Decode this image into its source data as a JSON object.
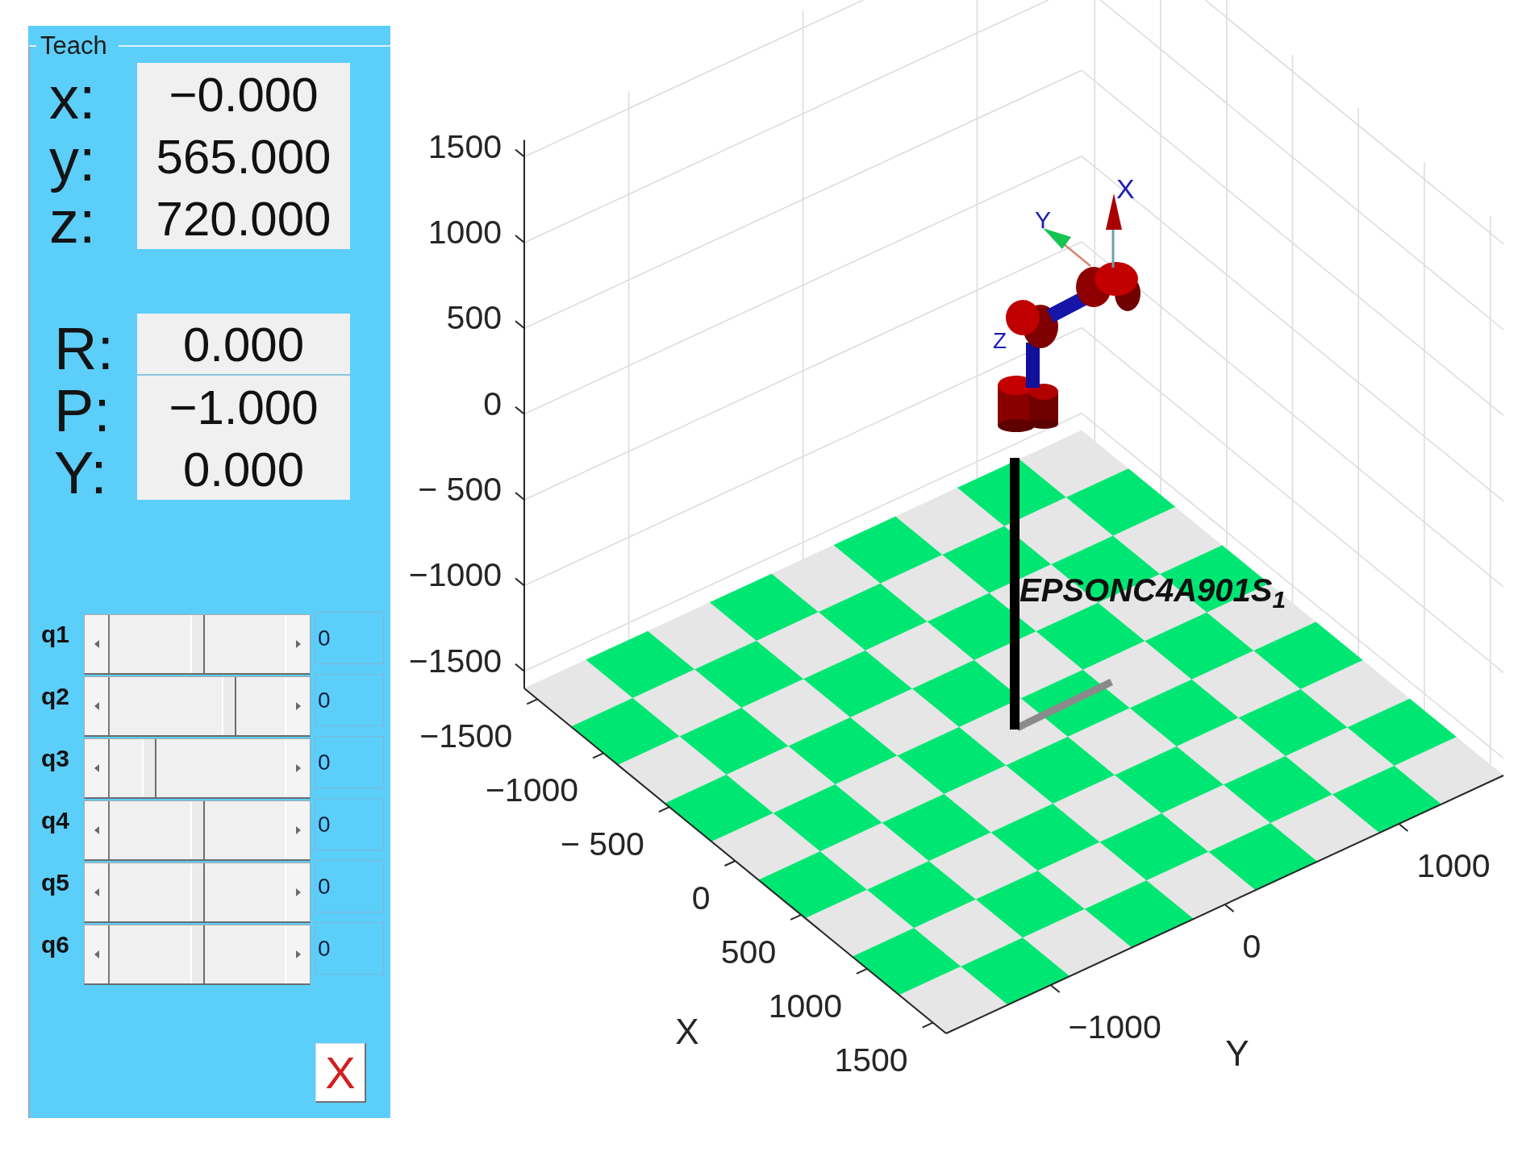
{
  "panel": {
    "title": "Teach",
    "position": [
      {
        "label": "x:",
        "value": "−0.000"
      },
      {
        "label": "y:",
        "value": "565.000"
      },
      {
        "label": "z:",
        "value": "720.000"
      }
    ],
    "orientation": [
      {
        "label": "R:",
        "value": "0.000"
      },
      {
        "label": "P:",
        "value": "−1.000"
      },
      {
        "label": "Y:",
        "value": "0.000"
      }
    ],
    "joints": [
      {
        "label": "q1",
        "level": 0.5,
        "value": "0"
      },
      {
        "label": "q2",
        "level": 0.7,
        "value": "0"
      },
      {
        "label": "q3",
        "level": 0.2,
        "value": "0"
      },
      {
        "label": "q4",
        "level": 0.5,
        "value": "0"
      },
      {
        "label": "q5",
        "level": 0.5,
        "value": "0"
      },
      {
        "label": "q6",
        "level": 0.5,
        "value": "0"
      }
    ],
    "close_button": {
      "label": "X"
    }
  },
  "plot": {
    "z_ticks": [
      "1500",
      "1000",
      "500",
      "0",
      "− 500",
      "−1000",
      "−1500"
    ],
    "x_ticks": [
      "−1500",
      "−1000",
      "− 500",
      "0",
      "500",
      "1000",
      "1500"
    ],
    "y_ticks": [
      "−1000",
      "0",
      "1000"
    ],
    "x_label": "X",
    "y_label": "Y",
    "robot_label": "EPSONC4A901S$_{1}$",
    "frame_labels": [
      "X",
      "Y",
      "Z"
    ]
  }
}
